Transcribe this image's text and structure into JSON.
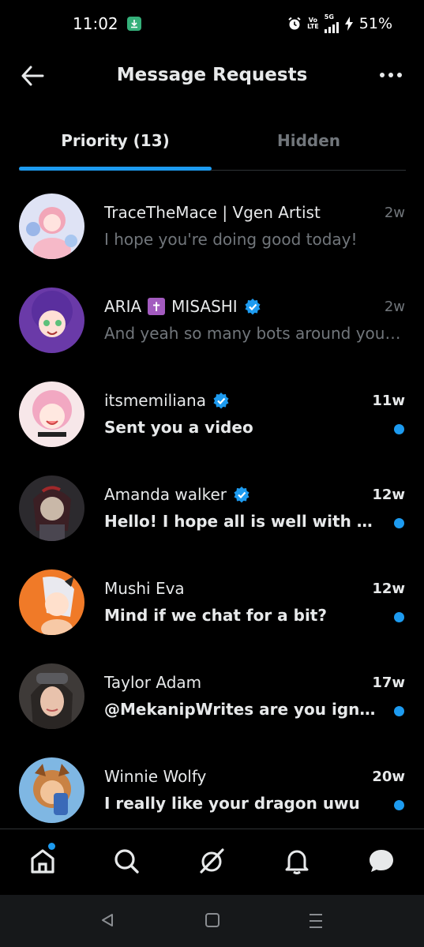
{
  "status": {
    "time": "11:02",
    "battery": "51%",
    "network_top": "Vo",
    "network_bottom": "LTE",
    "net_gen": "5G"
  },
  "header": {
    "title": "Message Requests"
  },
  "tabs": [
    {
      "label": "Priority (13)",
      "active": true
    },
    {
      "label": "Hidden",
      "active": false
    }
  ],
  "requests": [
    {
      "name": "TraceTheMace | Vgen Artist",
      "time": "2w",
      "preview": "I hope you're doing good today!",
      "unread": false,
      "verified": false
    },
    {
      "name_pre": "ARIA",
      "name_post": "MISASHI",
      "badge_glyph": "✝",
      "time": "2w",
      "preview": "And yeah so many bots around you ...",
      "unread": false,
      "verified": true
    },
    {
      "name": "itsmemiliana",
      "time": "11w",
      "preview": "Sent you a video",
      "unread": true,
      "verified": true
    },
    {
      "name": "Amanda walker",
      "time": "12w",
      "preview": "Hello! I hope all is well with you, ...",
      "unread": true,
      "verified": true
    },
    {
      "name": "Mushi Eva",
      "time": "12w",
      "preview": "Mind if we chat for a bit?",
      "unread": true,
      "verified": false
    },
    {
      "name": "Taylor Adam",
      "time": "17w",
      "preview": "@MekanipWrites are you ignorin...",
      "unread": true,
      "verified": false
    },
    {
      "name": "Winnie Wolfy",
      "time": "20w",
      "preview": "I really like your dragon uwu",
      "unread": true,
      "verified": false
    }
  ],
  "colors": {
    "accent": "#1d9bf0",
    "muted": "#71767b",
    "text": "#e7e9ea",
    "background": "#000000"
  },
  "nav": [
    "home-icon",
    "search-icon",
    "grok-icon",
    "bell-icon",
    "messages-icon"
  ]
}
